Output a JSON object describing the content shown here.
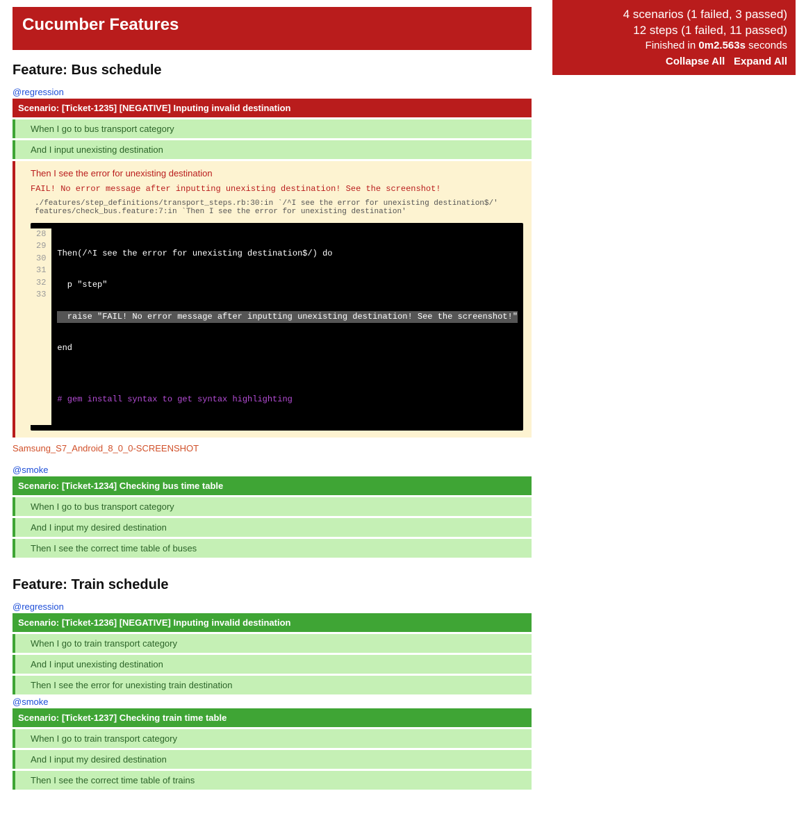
{
  "header": {
    "title": "Cucumber Features"
  },
  "summary": {
    "scenarios": "4 scenarios (1 failed, 3 passed)",
    "steps": "12 steps (1 failed, 11 passed)",
    "timing_prefix": "Finished in ",
    "timing_value": "0m2.563s",
    "timing_suffix": " seconds",
    "collapse": "Collapse All",
    "expand": "Expand All"
  },
  "features": [
    {
      "title": "Feature: Bus schedule",
      "scenarios": [
        {
          "tag": "@regression",
          "status": "failed",
          "name": "Scenario: [Ticket-1235] [NEGATIVE] Inputing invalid destination",
          "steps": [
            {
              "status": "passed",
              "text": "When I go to bus transport category"
            },
            {
              "status": "passed",
              "text": "And I input unexisting destination"
            }
          ],
          "failed": {
            "step_name": "Then I see the error for unexisting destination",
            "message": "FAIL! No error message after inputting unexisting destination! See the screenshot!",
            "trace_line1": "./features/step_definitions/transport_steps.rb:30:in `/^I see the error for unexisting destination$/'",
            "trace_line2": "features/check_bus.feature:7:in `Then I see the error for unexisting destination'",
            "code": {
              "lines": [
                "28",
                "29",
                "30",
                "31",
                "32",
                "33"
              ],
              "l28": "Then(/^I see the error for unexisting destination$/) do",
              "l29": "  p \"step\"",
              "l30": "  raise \"FAIL! No error message after inputting unexisting destination! See the screenshot!\"",
              "l31": "end",
              "l32": "",
              "l33": "# gem install syntax to get syntax highlighting"
            }
          },
          "screenshot": "Samsung_S7_Android_8_0_0-SCREENSHOT"
        },
        {
          "tag": "@smoke",
          "status": "passed",
          "name": "Scenario: [Ticket-1234] Checking bus time table",
          "steps": [
            {
              "status": "passed",
              "text": "When I go to bus transport category"
            },
            {
              "status": "passed",
              "text": "And I input my desired destination"
            },
            {
              "status": "passed",
              "text": "Then I see the correct time table of buses"
            }
          ]
        }
      ]
    },
    {
      "title": "Feature: Train schedule",
      "scenarios": [
        {
          "tag": "@regression",
          "status": "passed",
          "name": "Scenario: [Ticket-1236] [NEGATIVE] Inputing invalid destination",
          "steps": [
            {
              "status": "passed",
              "text": "When I go to train transport category"
            },
            {
              "status": "passed",
              "text": "And I input unexisting destination"
            },
            {
              "status": "passed",
              "text": "Then I see the error for unexisting train destination"
            }
          ]
        },
        {
          "tag": "@smoke",
          "status": "passed",
          "name": "Scenario: [Ticket-1237] Checking train time table",
          "steps": [
            {
              "status": "passed",
              "text": "When I go to train transport category"
            },
            {
              "status": "passed",
              "text": "And I input my desired destination"
            },
            {
              "status": "passed",
              "text": "Then I see the correct time table of trains"
            }
          ]
        }
      ]
    }
  ]
}
